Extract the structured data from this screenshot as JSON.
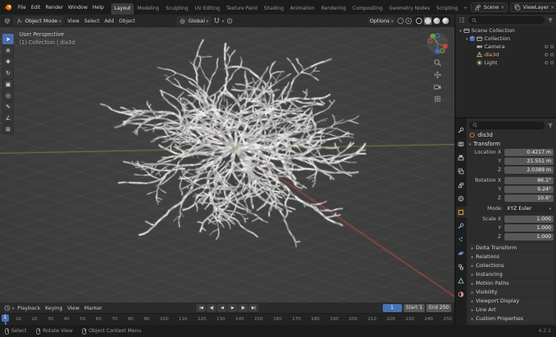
{
  "topbar": {
    "menus": [
      "File",
      "Edit",
      "Render",
      "Window",
      "Help"
    ],
    "workspaces": [
      "Layout",
      "Modeling",
      "Sculpting",
      "UV Editing",
      "Texture Paint",
      "Shading",
      "Animation",
      "Rendering",
      "Compositing",
      "Geometry Nodes",
      "Scripting"
    ],
    "active_workspace": "Layout",
    "add_workspace_label": "+",
    "scene": {
      "label": "Scene",
      "clear": "×"
    },
    "view_layer": {
      "label": "ViewLayer",
      "clear": "×"
    }
  },
  "viewport": {
    "header": {
      "mode": "Object Mode",
      "menus": [
        "View",
        "Select",
        "Add",
        "Object"
      ],
      "orientation": "Global",
      "options_label": "Options"
    },
    "overlay": {
      "line1": "User Perspective",
      "line2": "(1) Collection | dla3d"
    },
    "tools": [
      "select-box",
      "cursor",
      "move",
      "rotate",
      "scale",
      "transform",
      "annotate",
      "measure",
      "add-cube"
    ],
    "active_tool": "select-box",
    "nav_icons": [
      "zoom",
      "pan",
      "camera-view",
      "toggle-perspective"
    ],
    "axis_colors": {
      "x": "#cc4a42",
      "y": "#6fa336",
      "z": "#3f6fb8"
    }
  },
  "outliner": {
    "rows": [
      {
        "label": "Scene Collection",
        "icon": "collection",
        "depth": 0,
        "caret": true
      },
      {
        "label": "Collection",
        "icon": "collection",
        "depth": 1,
        "caret": true,
        "checkbox": true
      },
      {
        "label": "Camera",
        "icon": "camera",
        "depth": 2,
        "toggles": true
      },
      {
        "label": "dla3d",
        "icon": "mesh",
        "depth": 2,
        "toggles": true,
        "active": true
      },
      {
        "label": "Light",
        "icon": "light",
        "depth": 2,
        "toggles": true
      }
    ]
  },
  "properties": {
    "tabs": [
      "tool",
      "render",
      "output",
      "view-layer",
      "scene",
      "world",
      "object",
      "modifiers",
      "particles",
      "physics",
      "constraints",
      "data",
      "material"
    ],
    "active_tab": "object",
    "breadcrumb_object": "dla3d",
    "transform_title": "Transform",
    "fields": [
      {
        "label": "Location X",
        "value": "0.4217 m"
      },
      {
        "label": "Y",
        "value": "21.551 m"
      },
      {
        "label": "Z",
        "value": "2.0389 m"
      },
      {
        "label": "Rotation X",
        "value": "86.1°",
        "gap": true
      },
      {
        "label": "Y",
        "value": "9.24°"
      },
      {
        "label": "Z",
        "value": "10.6°"
      },
      {
        "label": "Mode",
        "value": "XYZ Euler",
        "dropdown": true,
        "gap": true
      },
      {
        "label": "Scale X",
        "value": "1.000",
        "gap": true
      },
      {
        "label": "Y",
        "value": "1.000"
      },
      {
        "label": "Z",
        "value": "1.000"
      }
    ],
    "collapsed_panels": [
      "Delta Transform",
      "Relations",
      "Collections",
      "Instancing",
      "Motion Paths",
      "Visibility",
      "Viewport Display",
      "Line Art",
      "Custom Properties"
    ]
  },
  "timeline": {
    "menus": [
      "Playback",
      "Keying",
      "View",
      "Marker"
    ],
    "transport": [
      "jump-start",
      "prev-keyframe",
      "play-reverse",
      "play",
      "next-keyframe",
      "jump-end"
    ],
    "current_frame": "1",
    "start_label": "Start",
    "start_value": "1",
    "end_label": "End",
    "end_value": "250",
    "playhead": "1",
    "ticks": [
      "0",
      "10",
      "20",
      "30",
      "40",
      "50",
      "60",
      "70",
      "80",
      "90",
      "100",
      "110",
      "120",
      "130",
      "140",
      "150",
      "160",
      "170",
      "180",
      "190",
      "200",
      "210",
      "220",
      "230",
      "240",
      "250"
    ]
  },
  "statusbar": {
    "hints": [
      "Select",
      "Rotate View",
      "Object Context Menu"
    ],
    "version": "4.2.1"
  }
}
